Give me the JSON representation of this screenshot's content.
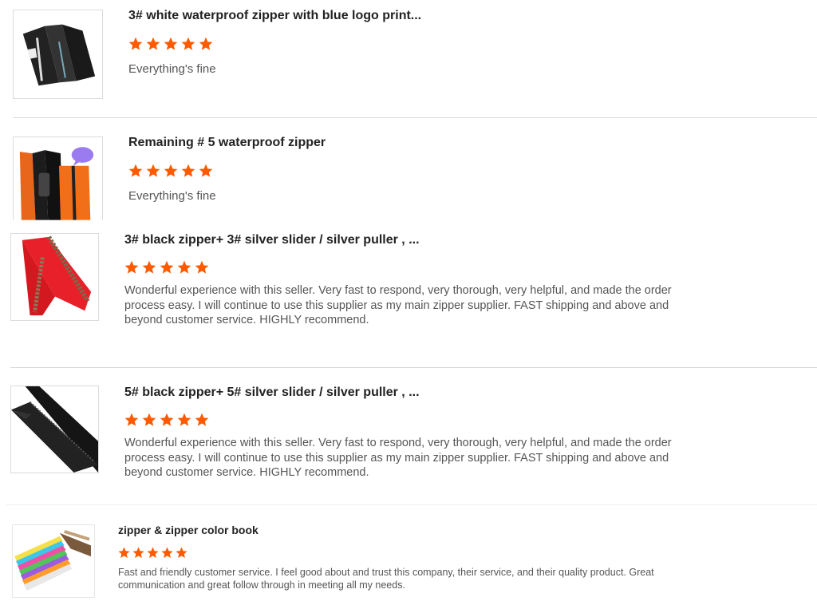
{
  "reviews": [
    {
      "title": "3# white waterproof zipper with blue logo print...",
      "rating": 5,
      "text": "Everything's fine",
      "image_icon": "black-waterproof-zipper-with-logo"
    },
    {
      "title": "Remaining # 5 waterproof zipper",
      "rating": 5,
      "text": "Everything's fine",
      "image_icon": "black-and-orange-zipper"
    },
    {
      "title": "3# black zipper+ 3# silver slider / silver puller , ...",
      "rating": 5,
      "text": "Wonderful experience with this seller. Very fast to respond, very thorough, very helpful, and made the order process easy. I will continue to use this supplier as my main zipper supplier. FAST shipping and above and beyond customer service. HIGHLY recommend.",
      "image_icon": "red-zipper-silver-teeth"
    },
    {
      "title": "5# black zipper+ 5# silver slider / silver puller , ...",
      "rating": 5,
      "text": "Wonderful experience with this seller. Very fast to respond, very thorough, very helpful, and made the order process easy. I will continue to use this supplier as my main zipper supplier. FAST shipping and above and beyond customer service. HIGHLY recommend.",
      "image_icon": "black-zipper"
    },
    {
      "title": "zipper & zipper color book",
      "rating": 5,
      "text": "Fast and friendly customer service. I feel good about and trust this company, their service, and their quality product. Great communication and great follow through in meeting all my needs.",
      "image_icon": "zipper-color-book"
    }
  ],
  "colors": {
    "star": "#ff5a00",
    "divider": "#d9d9d9",
    "text_muted": "#555555"
  }
}
